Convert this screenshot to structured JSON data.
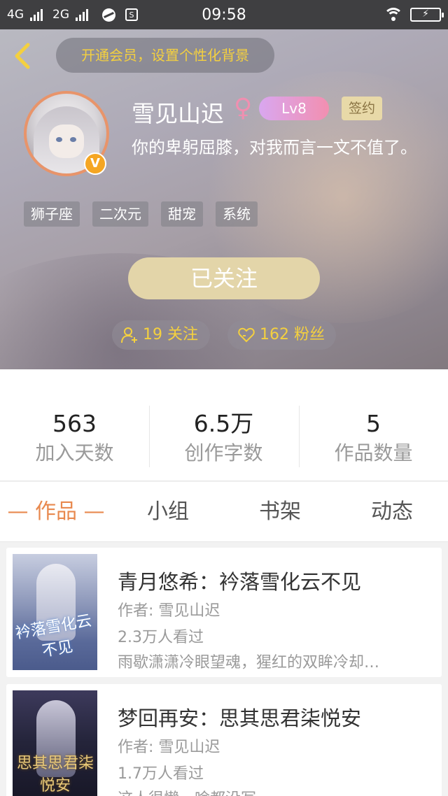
{
  "status_bar": {
    "network1": "4G",
    "network2": "2G",
    "sim_icon_label": "S",
    "time": "09:58"
  },
  "header": {
    "vip_tip": "开通会员，设置个性化背景",
    "username": "雪见山迟",
    "gender_symbol": "♀",
    "level": "Lv8",
    "signed_badge": "签约",
    "avatar_badge": "V",
    "bio": "你的卑躬屈膝，对我而言一文不值了。",
    "tags": [
      "狮子座",
      "二次元",
      "甜宠",
      "系统"
    ],
    "follow_button": "已关注",
    "following_count": "19 关注",
    "fans_count": "162 粉丝"
  },
  "stats": [
    {
      "value": "563",
      "label": "加入天数"
    },
    {
      "value": "6.5万",
      "label": "创作字数"
    },
    {
      "value": "5",
      "label": "作品数量"
    }
  ],
  "tabs": [
    {
      "label": "作品",
      "active": true
    },
    {
      "label": "小组",
      "active": false
    },
    {
      "label": "书架",
      "active": false
    },
    {
      "label": "动态",
      "active": false
    }
  ],
  "active_tab_decoration": "—",
  "books": [
    {
      "title": "青月悠希：衿落雪化云不见",
      "author": "作者: 雪见山迟",
      "views": "2.3万人看过",
      "desc": "雨歇潇潇冷眼望魂，猩红的双眸冷却…",
      "cover_text": "衿落雪化云不见"
    },
    {
      "title": "梦回再安：思其思君柒悦安",
      "author": "作者: 雪见山迟",
      "views": "1.7万人看过",
      "desc": "这人很懒，啥都没写",
      "cover_text": "思其思君柒悦安"
    }
  ],
  "colors": {
    "accent_orange": "#e8894f",
    "vip_yellow": "#f4d03f",
    "follow_button_bg": "#e3d5a9",
    "status_bar_bg": "#3f3f41"
  }
}
